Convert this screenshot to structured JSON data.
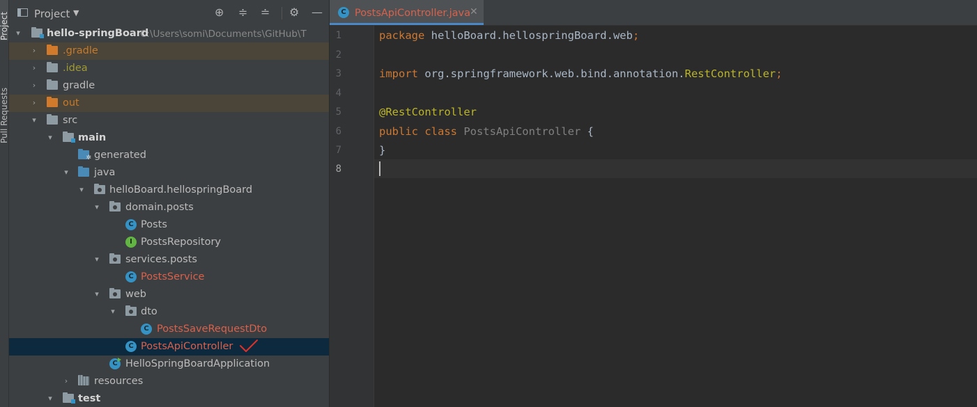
{
  "sidebar_strip": {
    "project_label": "Project",
    "pull_requests_label": "Pull Requests"
  },
  "panel": {
    "title": "Project",
    "tree": [
      {
        "label": "hello-springBoard",
        "path": "C:\\Users\\somi\\Documents\\GitHub\\T",
        "icon": "module-folder-icon",
        "style": "bold",
        "expanded": true
      },
      {
        "label": ".gradle",
        "icon": "folder-icon",
        "style": "orange"
      },
      {
        "label": ".idea",
        "icon": "folder-icon",
        "style": "olive"
      },
      {
        "label": "gradle",
        "icon": "folder-icon",
        "style": "gray"
      },
      {
        "label": "out",
        "icon": "folder-icon",
        "style": "orange"
      },
      {
        "label": "src",
        "icon": "folder-icon",
        "style": "gray",
        "expanded": true
      },
      {
        "label": "main",
        "icon": "module-folder-icon",
        "style": "bold",
        "expanded": true
      },
      {
        "label": "generated",
        "icon": "generated-folder-icon",
        "style": "gray"
      },
      {
        "label": "java",
        "icon": "source-folder-icon",
        "style": "gray",
        "expanded": true
      },
      {
        "label": "helloBoard.hellospringBoard",
        "icon": "package-icon",
        "style": "gray",
        "expanded": true
      },
      {
        "label": "domain.posts",
        "icon": "package-icon",
        "style": "gray",
        "expanded": true
      },
      {
        "label": "Posts",
        "icon": "class-icon",
        "style": "gray"
      },
      {
        "label": "PostsRepository",
        "icon": "interface-icon",
        "style": "gray"
      },
      {
        "label": "services.posts",
        "icon": "package-icon",
        "style": "gray",
        "expanded": true
      },
      {
        "label": "PostsService",
        "icon": "class-icon",
        "style": "red"
      },
      {
        "label": "web",
        "icon": "package-icon",
        "style": "gray",
        "expanded": true
      },
      {
        "label": "dto",
        "icon": "package-icon",
        "style": "gray",
        "expanded": true
      },
      {
        "label": "PostsSaveRequestDto",
        "icon": "class-icon",
        "style": "red"
      },
      {
        "label": "PostsApiController",
        "icon": "class-icon",
        "style": "red",
        "selected": true
      },
      {
        "label": "HelloSpringBoardApplication",
        "icon": "spring-app-class-icon",
        "style": "gray"
      },
      {
        "label": "resources",
        "icon": "resources-folder-icon",
        "style": "gray"
      },
      {
        "label": "test",
        "icon": "module-folder-icon",
        "style": "bold",
        "expanded": true
      }
    ]
  },
  "editor": {
    "tab_title": "PostsApiController.java",
    "line_numbers": [
      "1",
      "2",
      "3",
      "4",
      "5",
      "6",
      "7",
      "8"
    ],
    "current_line": 8,
    "code": {
      "line1_kw": "package",
      "line1_rest": " helloBoard.hellospringBoard.web",
      "line3_kw": "import",
      "line3_pkg": " org.springframework.web.bind.annotation.",
      "line3_cls": "RestController",
      "semicolon": ";",
      "line5_ann": "@RestController",
      "line6_kw": "public class",
      "line6_name": " PostsApiController",
      "line6_brace": " {",
      "line7": "}"
    }
  },
  "colors": {
    "accent": "#4a88c7",
    "modified_file": "#d9614c",
    "excluded_folder": "#c77a28",
    "selection": "#0d293e"
  }
}
